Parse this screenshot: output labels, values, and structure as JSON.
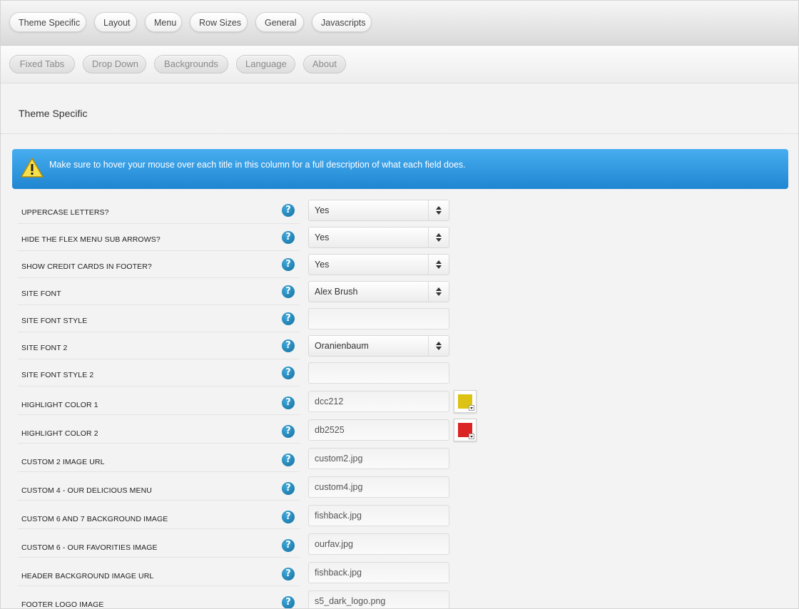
{
  "primary_tabs": [
    "Theme Specific",
    "Layout",
    "Menu",
    "Row Sizes",
    "General",
    "Javascripts"
  ],
  "secondary_tabs": [
    "Fixed Tabs",
    "Drop Down",
    "Backgrounds",
    "Language",
    "About"
  ],
  "section_title": "Theme Specific",
  "notice": {
    "icon": "warning-icon",
    "message": "Make sure to hover your mouse over each title in this column for a full description of what each field does."
  },
  "help_glyph": "?",
  "fields": [
    {
      "label": "Uppercase Letters?",
      "type": "select",
      "value": "Yes"
    },
    {
      "label": "Hide the Flex Menu Sub Arrows?",
      "type": "select",
      "value": "Yes"
    },
    {
      "label": "Show Credit Cards in Footer?",
      "type": "select",
      "value": "Yes"
    },
    {
      "label": "Site Font",
      "type": "select",
      "value": "Alex Brush"
    },
    {
      "label": "Site Font Style",
      "type": "text",
      "value": ""
    },
    {
      "label": "Site Font 2",
      "type": "select",
      "value": "Oranienbaum"
    },
    {
      "label": "Site Font Style 2",
      "type": "text",
      "value": ""
    },
    {
      "label": "Highlight Color 1",
      "type": "color",
      "value": "dcc212",
      "color": "#dcc212"
    },
    {
      "label": "Highlight Color 2",
      "type": "color",
      "value": "db2525",
      "color": "#db2525"
    },
    {
      "label": "Custom 2 Image URL",
      "type": "text",
      "value": "custom2.jpg"
    },
    {
      "label": "Custom 4 - Our Delicious Menu",
      "type": "text",
      "value": "custom4.jpg"
    },
    {
      "label": "Custom 6 and 7 Background Image",
      "type": "text",
      "value": "fishback.jpg"
    },
    {
      "label": "Custom 6 - Our Favorities Image",
      "type": "text",
      "value": "ourfav.jpg"
    },
    {
      "label": "Header Background Image URL",
      "type": "text",
      "value": "fishback.jpg"
    },
    {
      "label": "Footer Logo Image",
      "type": "text",
      "value": "s5_dark_logo.png"
    }
  ]
}
